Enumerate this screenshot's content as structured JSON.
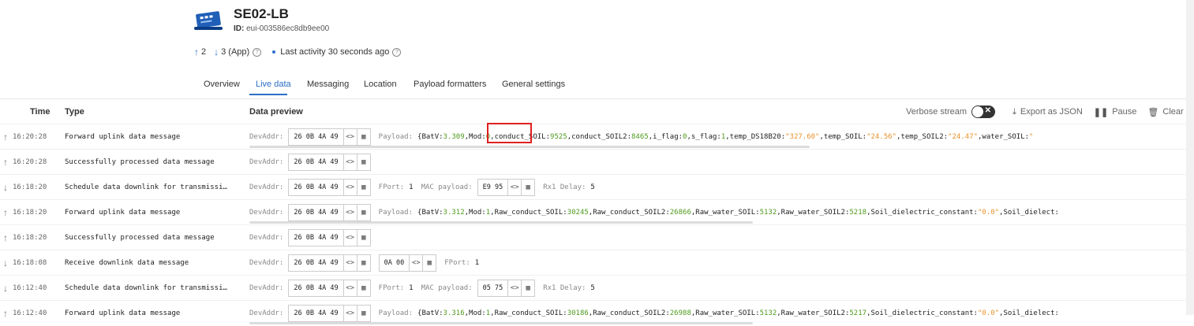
{
  "device": {
    "name": "SE02-LB",
    "id_label": "ID:",
    "id_value": "eui-003586ec8db9ee00",
    "icon": "device-board-icon"
  },
  "stats": {
    "uplink_count": "2",
    "downlink_count": "3 (App)",
    "last_activity": "Last activity 30 seconds ago"
  },
  "tabs": [
    "Overview",
    "Live data",
    "Messaging",
    "Location",
    "Payload formatters",
    "General settings"
  ],
  "active_tab": "Live data",
  "columns": {
    "time": "Time",
    "type": "Type",
    "preview": "Data preview"
  },
  "toolbar": {
    "verbose_label": "Verbose stream",
    "export_label": "Export as JSON",
    "pause_label": "Pause",
    "clear_label": "Clear"
  },
  "common": {
    "devaddr_label": "DevAddr:",
    "devaddr": "26 0B 4A 49",
    "payload_label": "Payload:",
    "fport_label": "FPort:",
    "mac_label": "MAC payload:",
    "rx1_label": "Rx1 Delay:"
  },
  "rows": [
    {
      "dir": "up",
      "time": "16:20:28",
      "type": "Forward uplink data message",
      "payload": [
        [
          "BatV",
          "3.309",
          "num"
        ],
        [
          "Mod",
          "0",
          "num"
        ],
        [
          "conduct_SOIL",
          "9525",
          "num"
        ],
        [
          "conduct_SOIL2",
          "8465",
          "num"
        ],
        [
          "i_flag",
          "0",
          "num"
        ],
        [
          "s_flag",
          "1",
          "num"
        ],
        [
          "temp_DS18B20",
          "\"327.60\"",
          "str"
        ],
        [
          "temp_SOIL",
          "\"24.56\"",
          "str"
        ],
        [
          "temp_SOIL2",
          "\"24.47\"",
          "str"
        ],
        [
          "water_SOIL",
          "\"",
          "str"
        ]
      ]
    },
    {
      "dir": "up",
      "time": "16:20:28",
      "type": "Successfully processed data message"
    },
    {
      "dir": "down",
      "time": "16:18:20",
      "type": "Schedule data downlink for transmissi…",
      "fport": "1",
      "mac": "E9 95",
      "rx1": "5"
    },
    {
      "dir": "up",
      "time": "16:18:20",
      "type": "Forward uplink data message",
      "payload": [
        [
          "BatV",
          "3.312",
          "num"
        ],
        [
          "Mod",
          "1",
          "num"
        ],
        [
          "Raw_conduct_SOIL",
          "30245",
          "num"
        ],
        [
          "Raw_conduct_SOIL2",
          "26866",
          "num"
        ],
        [
          "Raw_water_SOIL",
          "5132",
          "num"
        ],
        [
          "Raw_water_SOIL2",
          "5218",
          "num"
        ],
        [
          "Soil_dielectric_constant",
          "\"0.0\"",
          "str"
        ],
        [
          "Soil_dielect",
          "",
          "none"
        ]
      ]
    },
    {
      "dir": "up",
      "time": "16:18:20",
      "type": "Successfully processed data message"
    },
    {
      "dir": "down",
      "time": "16:18:08",
      "type": "Receive downlink data message",
      "frm": "0A 00",
      "fport": "1"
    },
    {
      "dir": "down",
      "time": "16:12:40",
      "type": "Schedule data downlink for transmissi…",
      "fport": "1",
      "mac": "05 75",
      "rx1": "5"
    },
    {
      "dir": "up",
      "time": "16:12:40",
      "type": "Forward uplink data message",
      "payload": [
        [
          "BatV",
          "3.316",
          "num"
        ],
        [
          "Mod",
          "1",
          "num"
        ],
        [
          "Raw_conduct_SOIL",
          "30186",
          "num"
        ],
        [
          "Raw_conduct_SOIL2",
          "26988",
          "num"
        ],
        [
          "Raw_water_SOIL",
          "5132",
          "num"
        ],
        [
          "Raw_water_SOIL2",
          "5217",
          "num"
        ],
        [
          "Soil_dielectric_constant",
          "\"0.0\"",
          "str"
        ],
        [
          "Soil_dielect",
          "",
          "none"
        ]
      ]
    }
  ],
  "colors": {
    "accent": "#2b6fc7",
    "number": "#4f9a1d",
    "string": "#e8922c",
    "highlight": "#e02020"
  }
}
